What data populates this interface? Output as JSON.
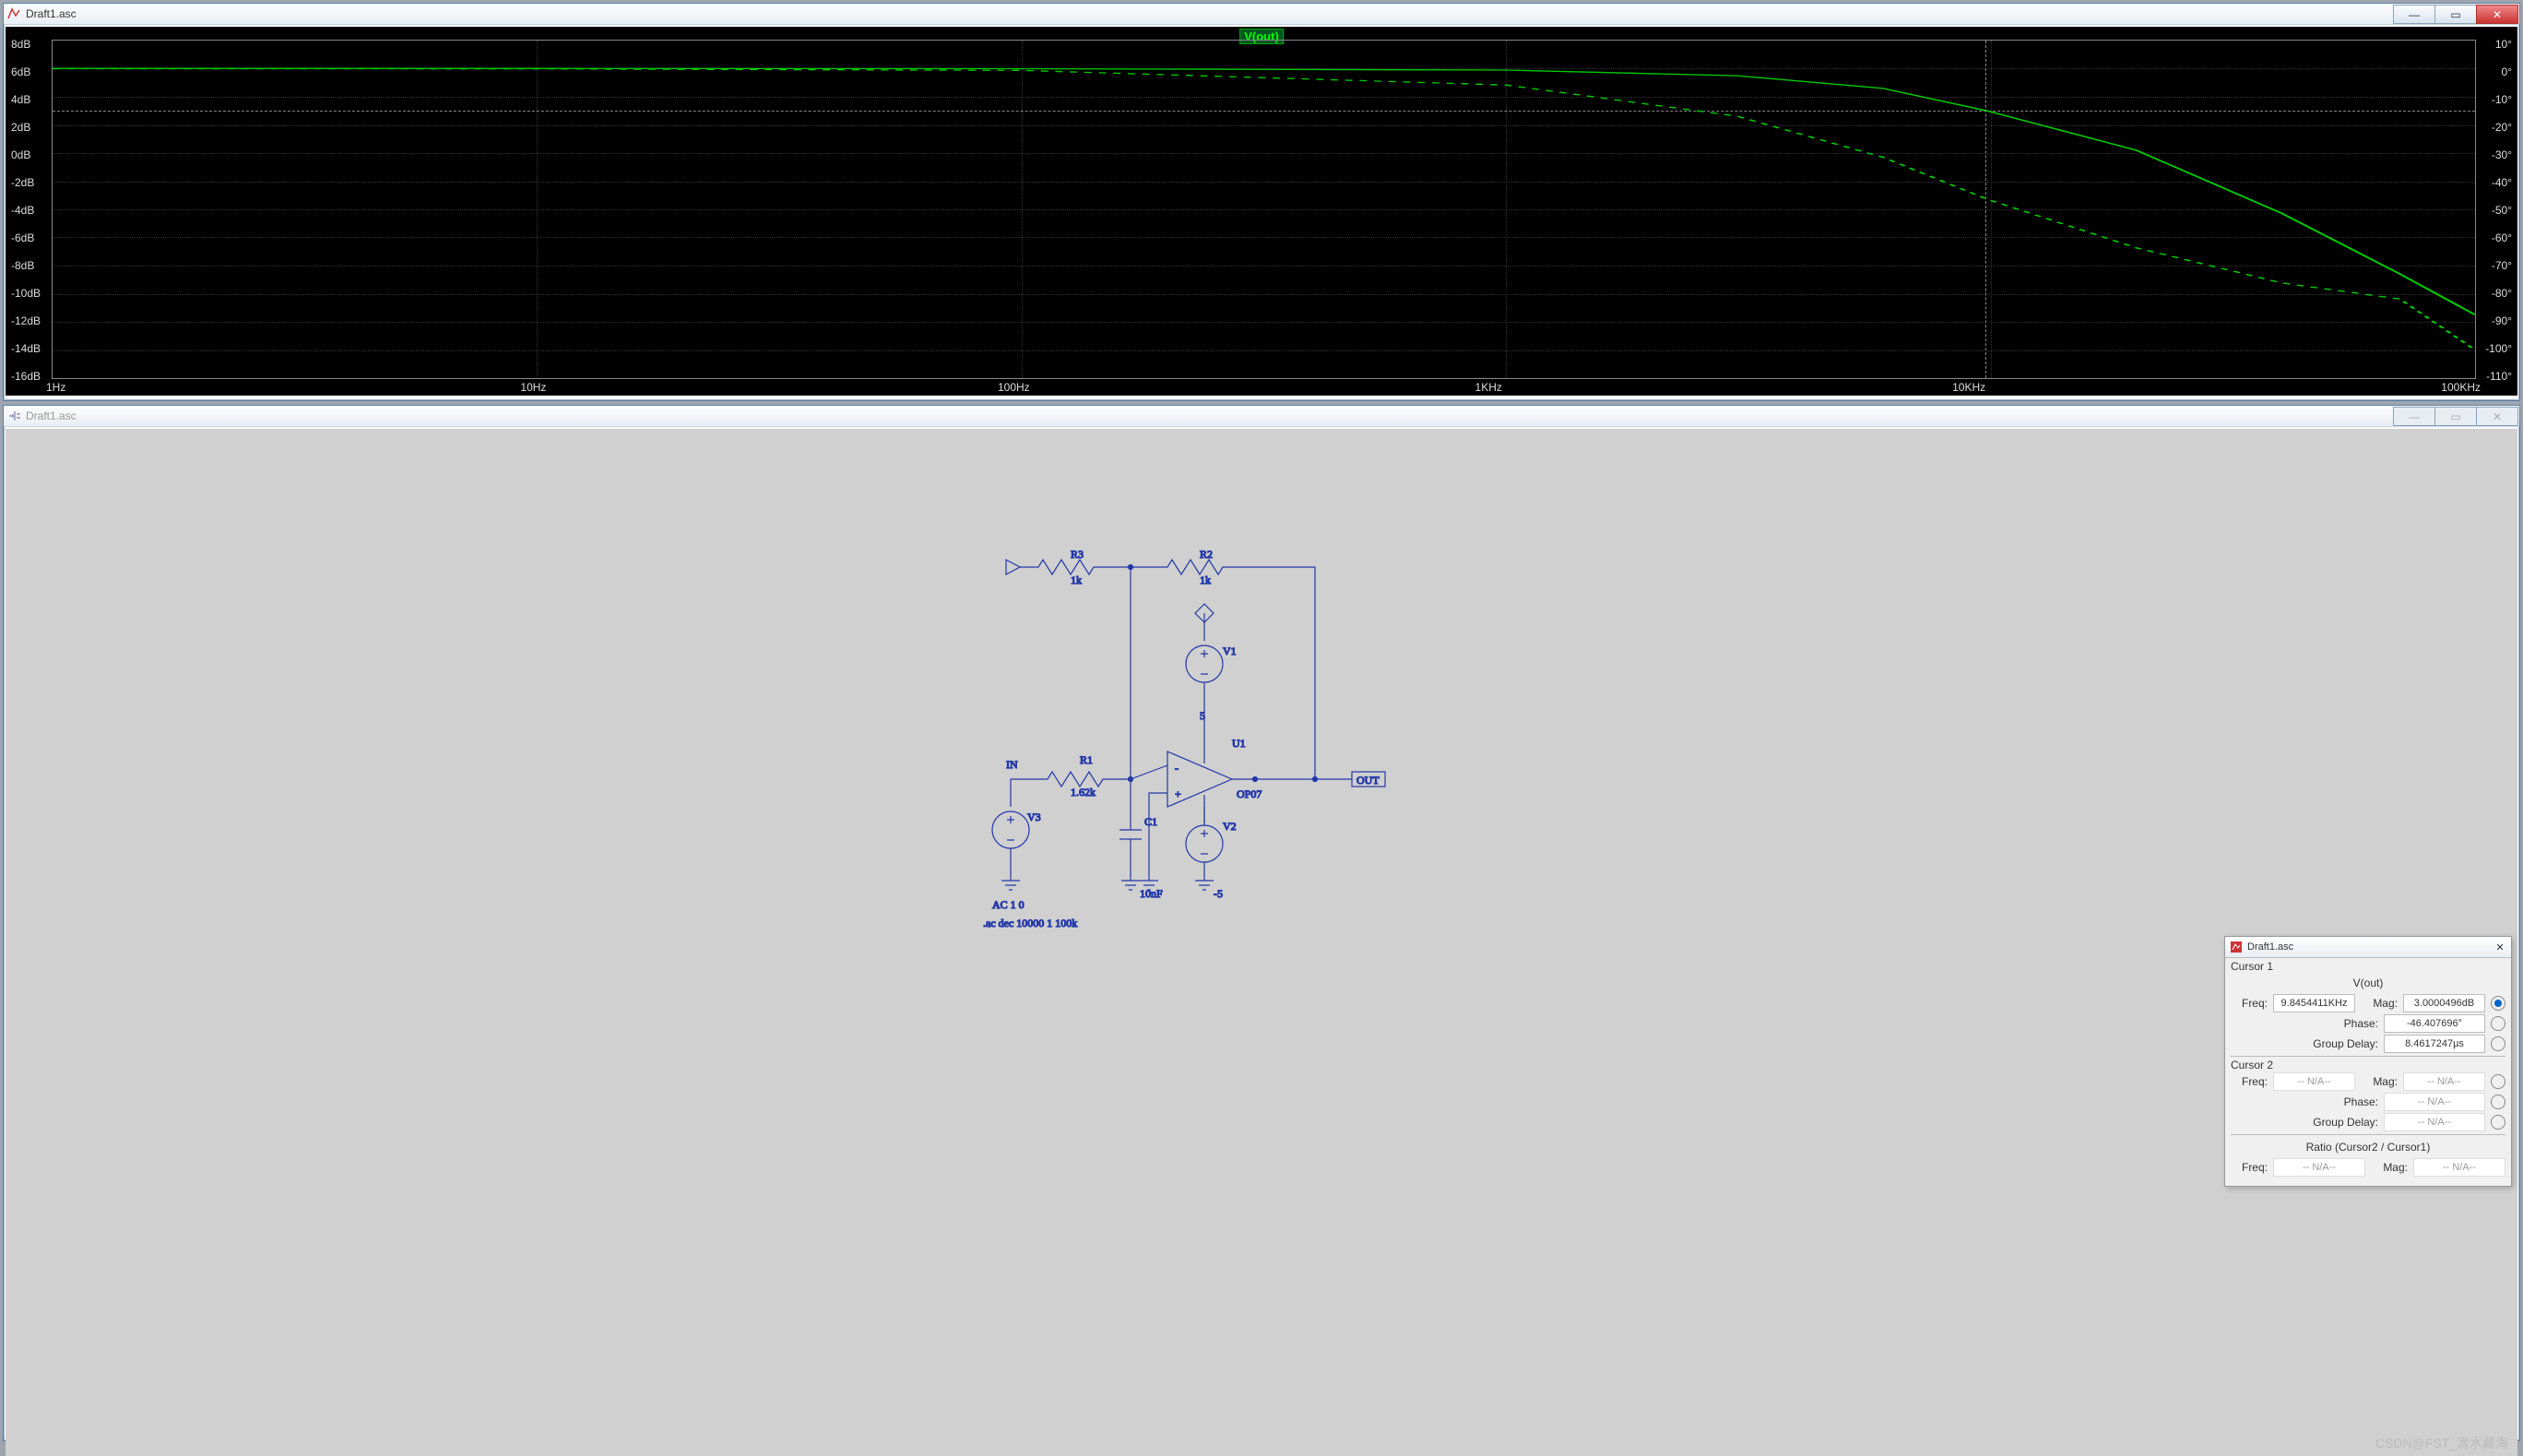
{
  "top_window": {
    "title": "Draft1.asc"
  },
  "bottom_window": {
    "title": "Draft1.asc"
  },
  "plot": {
    "trace_label": "V(out)",
    "y_left_ticks": [
      "8dB",
      "6dB",
      "4dB",
      "2dB",
      "0dB",
      "-2dB",
      "-4dB",
      "-6dB",
      "-8dB",
      "-10dB",
      "-12dB",
      "-14dB",
      "-16dB"
    ],
    "y_right_ticks": [
      "10°",
      "0°",
      "-10°",
      "-20°",
      "-30°",
      "-40°",
      "-50°",
      "-60°",
      "-70°",
      "-80°",
      "-90°",
      "-100°",
      "-110°"
    ],
    "x_ticks": [
      "1Hz",
      "10Hz",
      "100Hz",
      "1KHz",
      "10KHz",
      "100KHz"
    ]
  },
  "chart_data": {
    "type": "line",
    "xlabel": "Frequency",
    "xscale": "log",
    "xlim": [
      "1Hz",
      "100KHz"
    ],
    "y_left": {
      "label": "Magnitude",
      "unit": "dB",
      "lim": [
        -16,
        8
      ]
    },
    "y_right": {
      "label": "Phase",
      "unit": "°",
      "lim": [
        -110,
        10
      ]
    },
    "series": [
      {
        "name": "V(out) magnitude",
        "axis": "left",
        "x_hz": [
          1,
          10,
          100,
          1000,
          3000,
          6000,
          9845,
          20000,
          40000,
          70000,
          100000
        ],
        "y": [
          6.02,
          6.02,
          6.0,
          5.9,
          5.5,
          4.6,
          3.0,
          0.2,
          -4.3,
          -8.6,
          -11.5
        ]
      },
      {
        "name": "V(out) phase",
        "axis": "right",
        "x_hz": [
          1,
          10,
          100,
          1000,
          3000,
          6000,
          9845,
          20000,
          40000,
          70000,
          100000
        ],
        "y": [
          0,
          -0.06,
          -0.6,
          -5.8,
          -16.9,
          -31.5,
          -46.4,
          -63.7,
          -76.2,
          -81.9,
          -100
        ]
      }
    ],
    "cursor1": {
      "freq_hz": 9845.4411,
      "mag_db": 3.0000496,
      "phase_deg": -46.407696,
      "group_delay_us": 8.4617247
    }
  },
  "schematic": {
    "in_label": "IN",
    "out_label": "OUT",
    "R1": {
      "ref": "R1",
      "val": "1.62k"
    },
    "R2": {
      "ref": "R2",
      "val": "1k"
    },
    "R3": {
      "ref": "R3",
      "val": "1k"
    },
    "C1": {
      "ref": "C1",
      "val": "10nF"
    },
    "V1": {
      "ref": "V1",
      "val": "5"
    },
    "V2": {
      "ref": "V2",
      "val": "-5"
    },
    "V3": {
      "ref": "V3",
      "val": "AC 1 0"
    },
    "U1": {
      "ref": "U1",
      "val": "OP07"
    },
    "directive": ".ac dec 10000 1 100k"
  },
  "cursor_panel": {
    "title": "Draft1.asc",
    "c1": "Cursor 1",
    "c2": "Cursor 2",
    "sig": "V(out)",
    "freq_l": "Freq:",
    "mag_l": "Mag:",
    "phase_l": "Phase:",
    "gd_l": "Group Delay:",
    "c1freq": "9.8454411KHz",
    "c1mag": "3.0000496dB",
    "c1phase": "-46.407696°",
    "c1gd": "8.4617247µs",
    "na": "-- N/A--",
    "ratio": "Ratio (Cursor2 / Cursor1)"
  },
  "watermark": "CSDN@FST_滴水藏海"
}
